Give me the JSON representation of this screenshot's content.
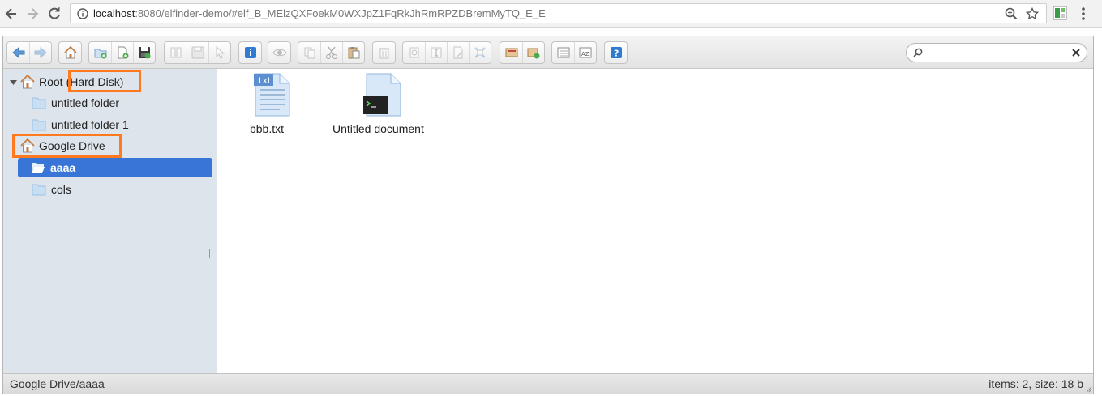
{
  "browser": {
    "url_host": "localhost",
    "url_path": ":8080/elfinder-demo/#elf_B_MElzQXFoekM0WXJpZ1FqRkJhRmRPZDBremMyTQ_E_E"
  },
  "search": {
    "placeholder": "",
    "value": ""
  },
  "tree": {
    "root_label": "Root",
    "root_note": "(Hard Disk)",
    "root_children": [
      "untitled folder",
      "untitled folder 1"
    ],
    "drive_label": "Google Drive",
    "drive_children": [
      "aaaa",
      "cols"
    ]
  },
  "files": [
    {
      "name": "bbb.txt",
      "badge": "txt",
      "icon": "text-file-icon"
    },
    {
      "name": "Untitled document",
      "icon": "executable-file-icon"
    }
  ],
  "status": {
    "path": "Google Drive/aaaa",
    "size": "items: 2, size: 18 b"
  },
  "colors": {
    "selected": "#3875d7",
    "highlight": "#ff7a1f",
    "nav_bg": "#dde4eb"
  }
}
